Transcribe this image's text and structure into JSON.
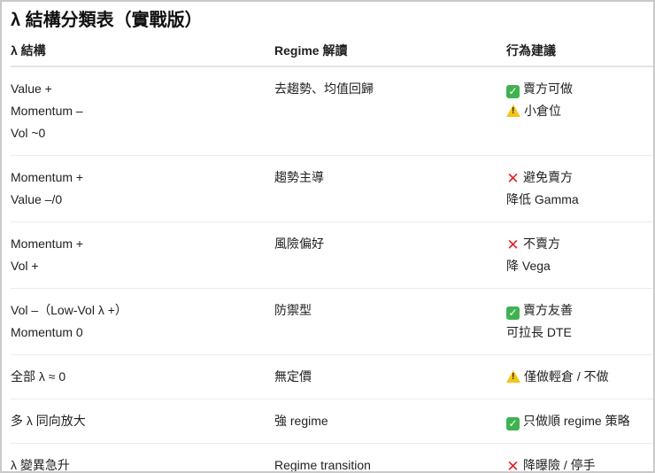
{
  "title": "λ 結構分類表（實戰版）",
  "headers": [
    "λ 結構",
    "Regime 解讀",
    "行為建議"
  ],
  "rows": [
    {
      "structure": [
        "Value +",
        "Momentum –",
        "Vol ~0"
      ],
      "regime": [
        "去趨勢、均值回歸"
      ],
      "action": [
        {
          "icon": "check",
          "text": "賣方可做"
        },
        {
          "icon": "warn",
          "text": "小倉位"
        }
      ]
    },
    {
      "structure": [
        "Momentum +",
        "Value –/0"
      ],
      "regime": [
        "趨勢主導"
      ],
      "action": [
        {
          "icon": "cross",
          "text": "避免賣方"
        },
        {
          "icon": "",
          "text": "降低 Gamma"
        }
      ]
    },
    {
      "structure": [
        "Momentum +",
        "Vol +"
      ],
      "regime": [
        "風險偏好"
      ],
      "action": [
        {
          "icon": "cross",
          "text": "不賣方"
        },
        {
          "icon": "",
          "text": "降 Vega"
        }
      ]
    },
    {
      "structure": [
        "Vol –（Low-Vol λ +）",
        "Momentum 0"
      ],
      "regime": [
        "防禦型"
      ],
      "action": [
        {
          "icon": "check",
          "text": "賣方友善"
        },
        {
          "icon": "",
          "text": "可拉長 DTE"
        }
      ]
    },
    {
      "structure": [
        "全部 λ ≈ 0"
      ],
      "regime": [
        "無定價"
      ],
      "action": [
        {
          "icon": "warn",
          "text": "僅做輕倉 / 不做"
        }
      ]
    },
    {
      "structure": [
        "多 λ 同向放大"
      ],
      "regime": [
        "強 regime"
      ],
      "action": [
        {
          "icon": "check",
          "text": "只做順 regime 策略"
        }
      ]
    },
    {
      "structure": [
        "λ 變異急升"
      ],
      "regime": [
        "Regime transition"
      ],
      "action": [
        {
          "icon": "cross",
          "text": "降曝險 / 停手"
        }
      ]
    }
  ]
}
